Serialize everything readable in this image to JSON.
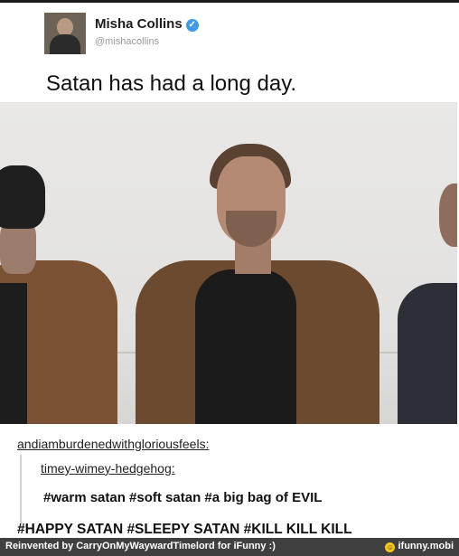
{
  "tweet": {
    "name": "Misha Collins",
    "handle": "@mishacollins",
    "text": "Satan has had a long day."
  },
  "thread": {
    "user1": "andiamburdenedwithgloriousfeels:",
    "user2": "timey-wimey-hedgehog:",
    "tags_line1": "#warm satan #soft satan #a big bag of EVIL",
    "tags_line2": "#HAPPY SATAN #SLEEPY SATAN #KILL KILL KILL"
  },
  "footer": {
    "credit": "Reinvented by CarryOnMyWaywardTimelord for iFunny :)",
    "brand": "ifunny.mobi"
  },
  "colors": {
    "verified": "#3f9be6",
    "footer_bg": "#404040"
  },
  "icons": [
    "verified-badge-icon",
    "ifunny-smiley-icon"
  ]
}
